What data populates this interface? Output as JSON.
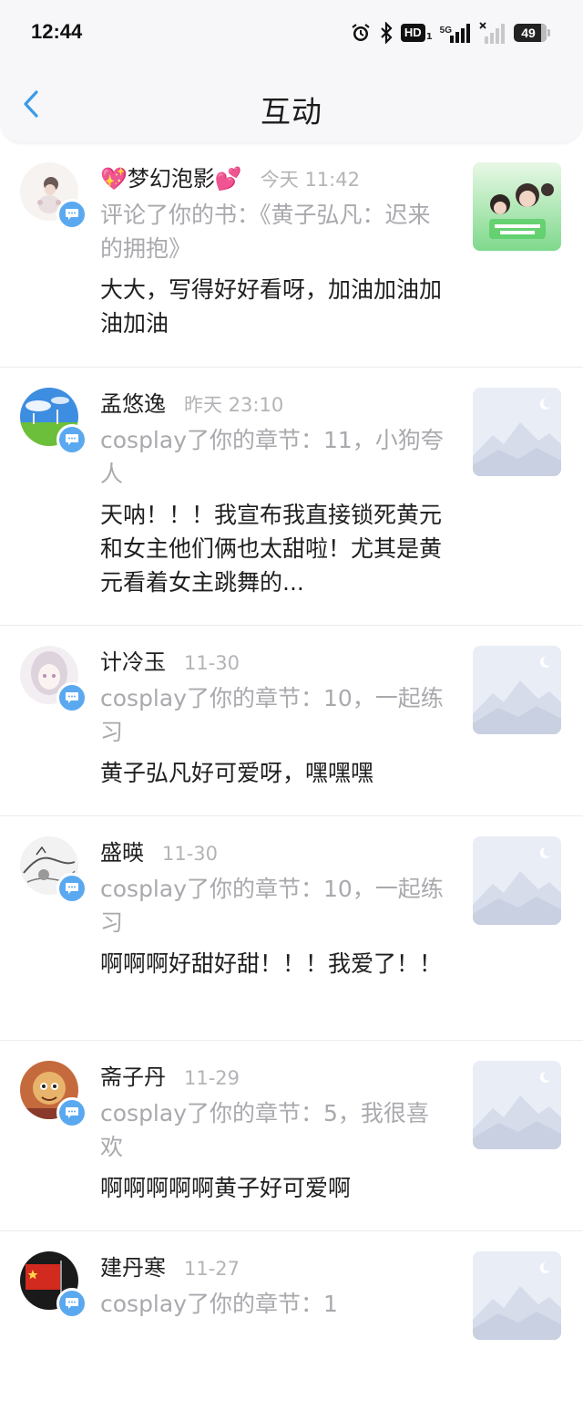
{
  "status_bar": {
    "time": "12:44",
    "hd": "HD",
    "hd_sub": "1",
    "network": "5G",
    "battery": "49",
    "icons": [
      "alarm-icon",
      "bluetooth-icon",
      "hd-icon",
      "signal-5g-icon",
      "signal-empty-icon",
      "battery-icon"
    ]
  },
  "header": {
    "title": "互动",
    "back_icon": "back-chevron-icon",
    "accent_color": "#3a9be8"
  },
  "items": [
    {
      "name": "💖梦幻泡影💕",
      "time": "今天 11:42",
      "action": "评论了你的书：《黄子弘凡：迟来的拥抱》",
      "comment": "大大，写得好好看呀，加油加油加油加油",
      "thumb": "book-cover",
      "avatar": "avatar-doll"
    },
    {
      "name": "孟悠逸",
      "time": "昨天 23:10",
      "action": "cosplay了你的章节：11，小狗夸人",
      "comment": "天呐！！！我宣布我直接锁死黄元和女主他们俩也太甜啦！尤其是黄元看着女主跳舞的...",
      "thumb": "placeholder",
      "avatar": "avatar-landscape"
    },
    {
      "name": "计冷玉",
      "time": "11-30",
      "action": "cosplay了你的章节：10，一起练习",
      "comment": "黄子弘凡好可爱呀，嘿嘿嘿",
      "thumb": "placeholder",
      "avatar": "avatar-anime"
    },
    {
      "name": "盛暎",
      "time": "11-30",
      "action": "cosplay了你的章节：10，一起练习",
      "comment": "啊啊啊好甜好甜！！！我爱了！！",
      "thumb": "placeholder",
      "avatar": "avatar-sketch"
    },
    {
      "name": "斋子丹",
      "time": "11-29",
      "action": "cosplay了你的章节：5，我很喜欢",
      "comment": "啊啊啊啊啊黄子好可爱啊",
      "thumb": "placeholder",
      "avatar": "avatar-cartoon"
    },
    {
      "name": "建丹寒",
      "time": "11-27",
      "action": "cosplay了你的章节：1",
      "comment": "",
      "thumb": "placeholder",
      "avatar": "avatar-flag"
    }
  ]
}
